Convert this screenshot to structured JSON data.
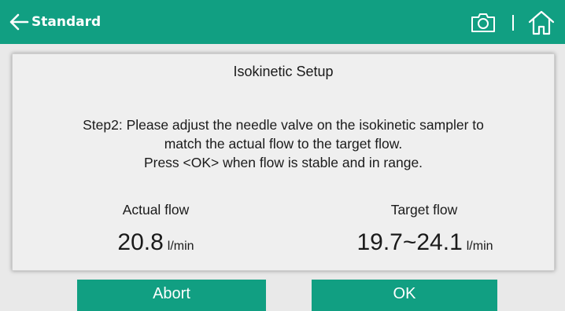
{
  "header": {
    "back_label": "Standard",
    "icons": [
      "arrow-left-icon",
      "camera-icon",
      "home-icon"
    ]
  },
  "dialog": {
    "title": "Isokinetic Setup",
    "instructions": [
      "Step2: Please adjust the needle valve on the isokinetic sampler to",
      "match the actual flow to the target flow.",
      "Press <OK> when flow is stable and in range."
    ],
    "actual": {
      "label": "Actual flow",
      "value": "20.8",
      "unit": "l/min"
    },
    "target": {
      "label": "Target flow",
      "value": "19.7~24.1",
      "unit": "l/min"
    }
  },
  "buttons": {
    "abort": "Abort",
    "ok": "OK"
  },
  "colors": {
    "accent": "#119f82",
    "background": "#e9e9e9",
    "panel": "#efefef"
  }
}
